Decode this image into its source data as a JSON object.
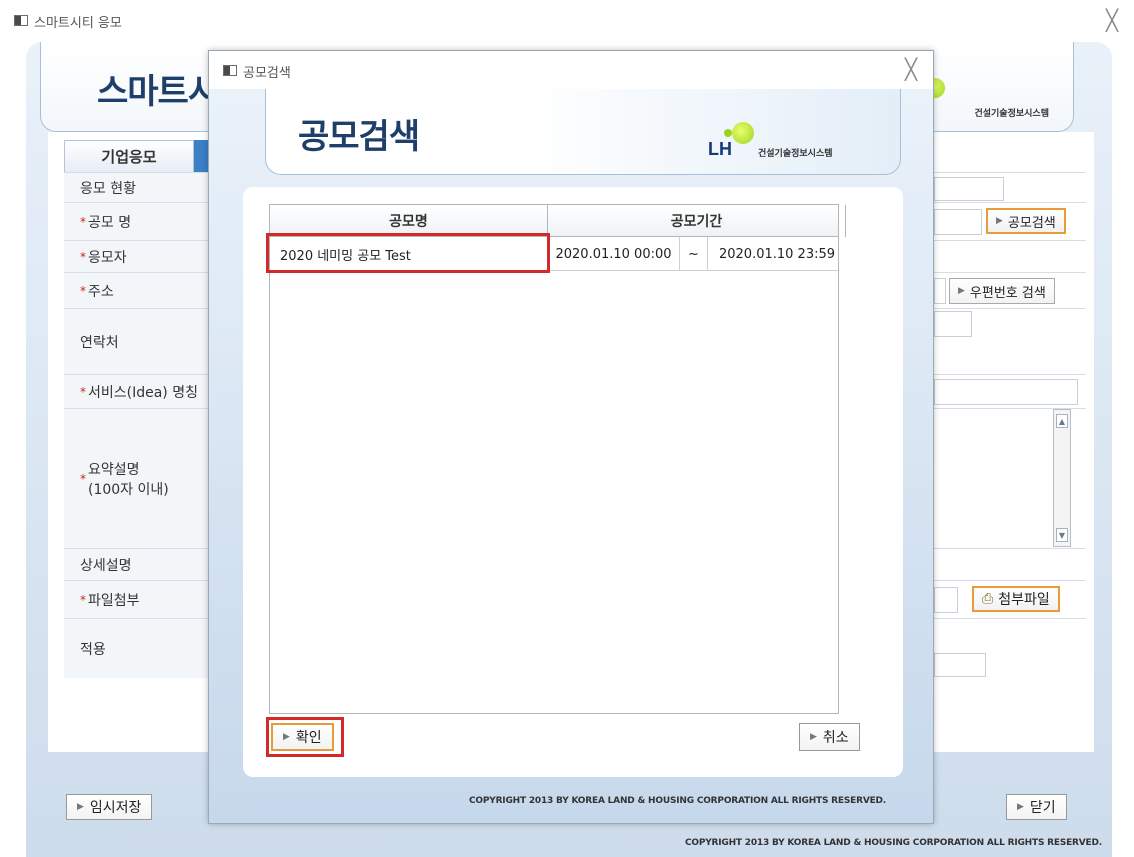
{
  "main_window": {
    "title": "스마트시티 응모",
    "close_label": "╳",
    "header_title": "스마트시",
    "brand_text": "건설기술정보시스템",
    "tab_label": "기업응모",
    "rows": [
      {
        "label": "응모 현황",
        "required": false
      },
      {
        "label": "공모 명",
        "required": true
      },
      {
        "label": "응모자",
        "required": true
      },
      {
        "label": "주소",
        "required": true
      },
      {
        "label": "연락처",
        "required": false
      },
      {
        "label": "서비스(Idea) 명칭",
        "required": true
      },
      {
        "label": "요약설명\n(100자 이내)",
        "required": true
      },
      {
        "label": "상세설명",
        "required": false
      },
      {
        "label": "파일첨부",
        "required": true
      },
      {
        "label": "적용",
        "required": false
      }
    ],
    "buttons": {
      "contest_search": "공모검색",
      "zipcode_search": "우편번호 검색",
      "attach_file": "첨부파일",
      "temp_save": "임시저장",
      "close": "닫기"
    },
    "copyright": "COPYRIGHT 2013 BY KOREA LAND & HOUSING CORPORATION ALL RIGHTS RESERVED.",
    "colors": {
      "required_mark": "#d21e1e",
      "accent_orange": "#e79b3a",
      "title_blue": "#1f3f6b"
    }
  },
  "modal": {
    "title": "공모검색",
    "close_label": "╳",
    "header_title": "공모검색",
    "logo_text": "LH",
    "brand_text": "건설기술정보시스템",
    "grid": {
      "columns": [
        "공모명",
        "공모기간"
      ],
      "rows": [
        {
          "name": "2020 네미밍 공모 Test",
          "start": "2020.01.10 00:00",
          "sep": "~",
          "end": "2020.01.10 23:59"
        }
      ]
    },
    "buttons": {
      "confirm": "확인",
      "cancel": "취소"
    },
    "copyright": "COPYRIGHT 2013 BY KOREA LAND & HOUSING CORPORATION ALL RIGHTS RESERVED.",
    "colors": {
      "highlight_red": "#d22a2a"
    }
  }
}
